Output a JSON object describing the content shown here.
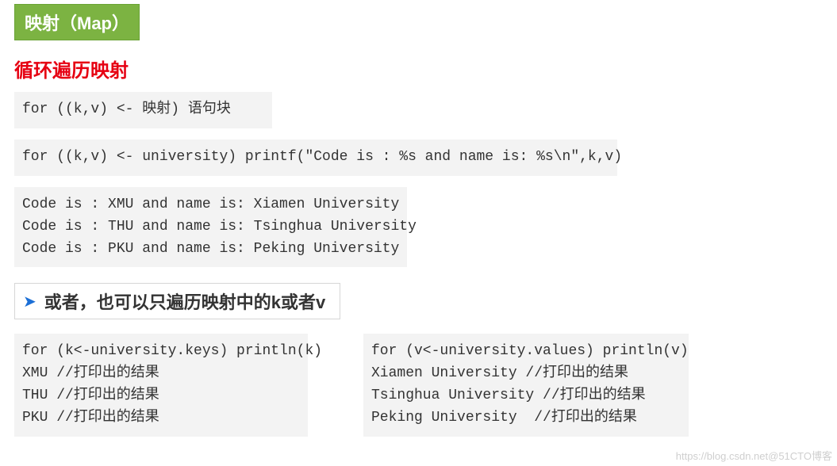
{
  "badge": "映射（Map）",
  "heading": "循环遍历映射",
  "code1": "for ((k,v) <- 映射) 语句块",
  "code2": "for ((k,v) <- university) printf(\"Code is : %s and name is: %s\\n\",k,v)",
  "code3": "Code is : XMU and name is: Xiamen University\nCode is : THU and name is: Tsinghua University\nCode is : PKU and name is: Peking University",
  "sub_heading": "或者，也可以只遍历映射中的k或者v",
  "code_left": "for (k<-university.keys) println(k)\nXMU //打印出的结果\nTHU //打印出的结果\nPKU //打印出的结果",
  "code_right": "for (v<-university.values) println(v)\nXiamen University //打印出的结果\nTsinghua University //打印出的结果\nPeking University  //打印出的结果",
  "watermark": "https://blog.csdn.net@51CTO博客"
}
